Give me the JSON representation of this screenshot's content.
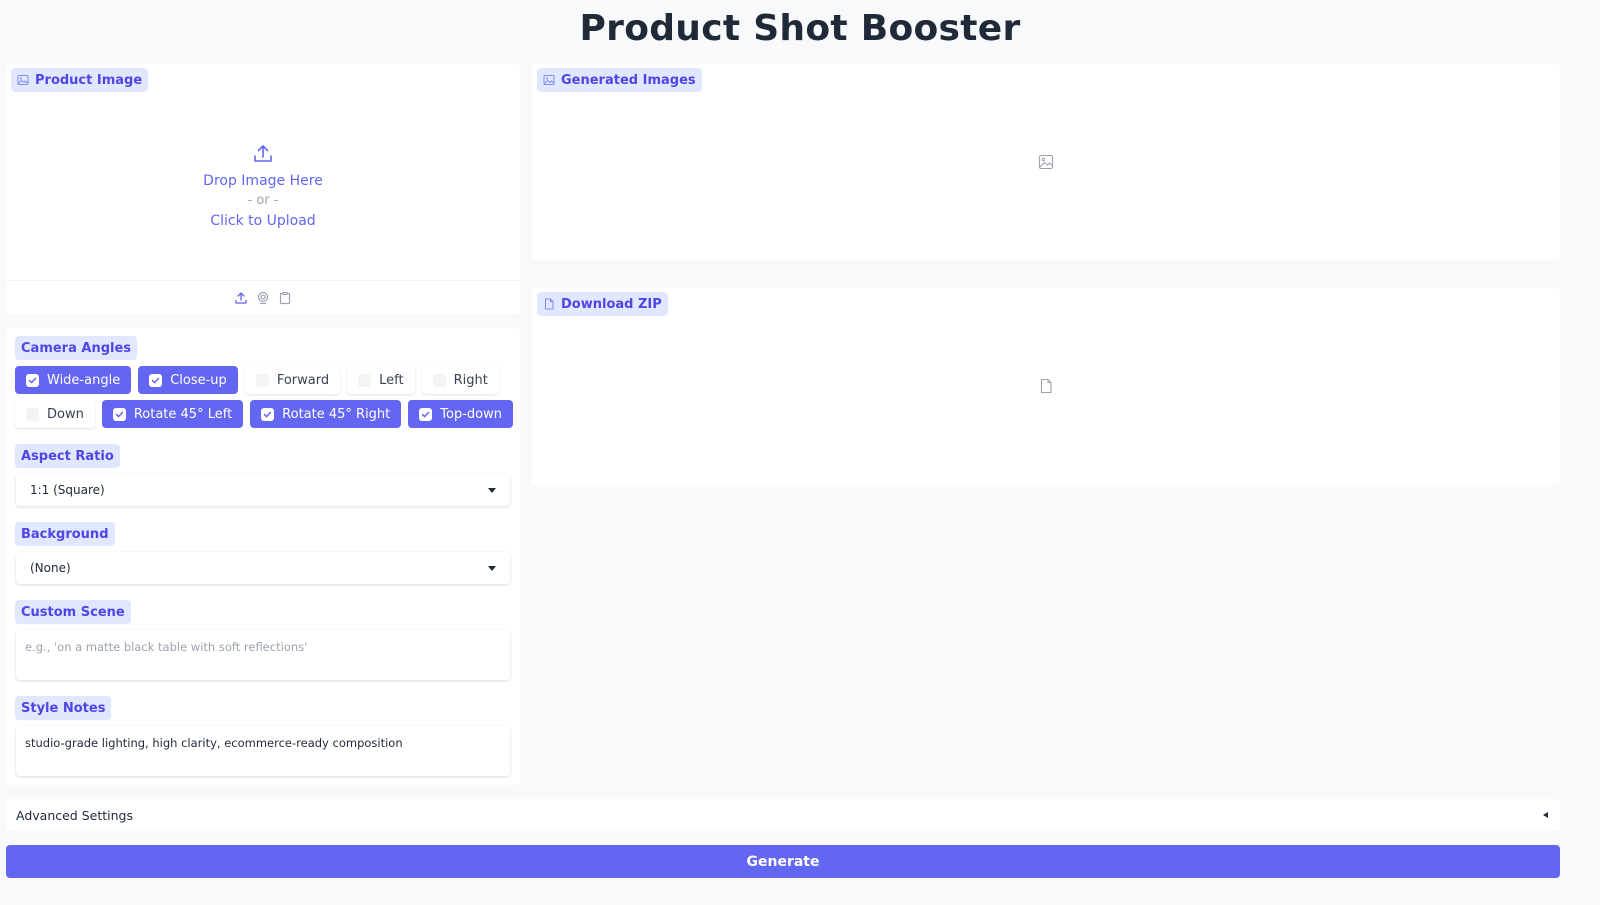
{
  "app": {
    "title": "Product Shot Booster"
  },
  "product_image": {
    "label": "Product Image",
    "drop_text": "Drop Image Here",
    "or_text": "- or -",
    "click_text": "Click to Upload"
  },
  "controls": {
    "camera_angles": {
      "label": "Camera Angles",
      "options": [
        {
          "label": "Wide-angle",
          "checked": true
        },
        {
          "label": "Close-up",
          "checked": true
        },
        {
          "label": "Forward",
          "checked": false
        },
        {
          "label": "Left",
          "checked": false
        },
        {
          "label": "Right",
          "checked": false
        },
        {
          "label": "Down",
          "checked": false
        },
        {
          "label": "Rotate 45° Left",
          "checked": true
        },
        {
          "label": "Rotate 45° Right",
          "checked": true
        },
        {
          "label": "Top-down",
          "checked": true
        }
      ]
    },
    "aspect_ratio": {
      "label": "Aspect Ratio",
      "value": "1:1 (Square)"
    },
    "background": {
      "label": "Background",
      "value": "(None)"
    },
    "custom_scene": {
      "label": "Custom Scene",
      "value": "",
      "placeholder": "e.g., 'on a matte black table with soft reflections'"
    },
    "style_notes": {
      "label": "Style Notes",
      "value": "studio-grade lighting, high clarity, ecommerce-ready composition"
    }
  },
  "output": {
    "generated_label": "Generated Images",
    "download_label": "Download ZIP"
  },
  "advanced": {
    "label": "Advanced Settings"
  },
  "actions": {
    "generate_label": "Generate"
  },
  "colors": {
    "accent": "#6366f1",
    "badge_bg": "#e0e7ff",
    "badge_text": "#4f46e5",
    "page_bg": "#f8f9fb"
  },
  "icons": {
    "image_label_icon": "image-icon",
    "file_label_icon": "file-icon",
    "upload_icon": "upload-icon",
    "webcam_icon": "webcam-icon",
    "clipboard_icon": "clipboard-icon",
    "check_icon": "check-icon"
  }
}
